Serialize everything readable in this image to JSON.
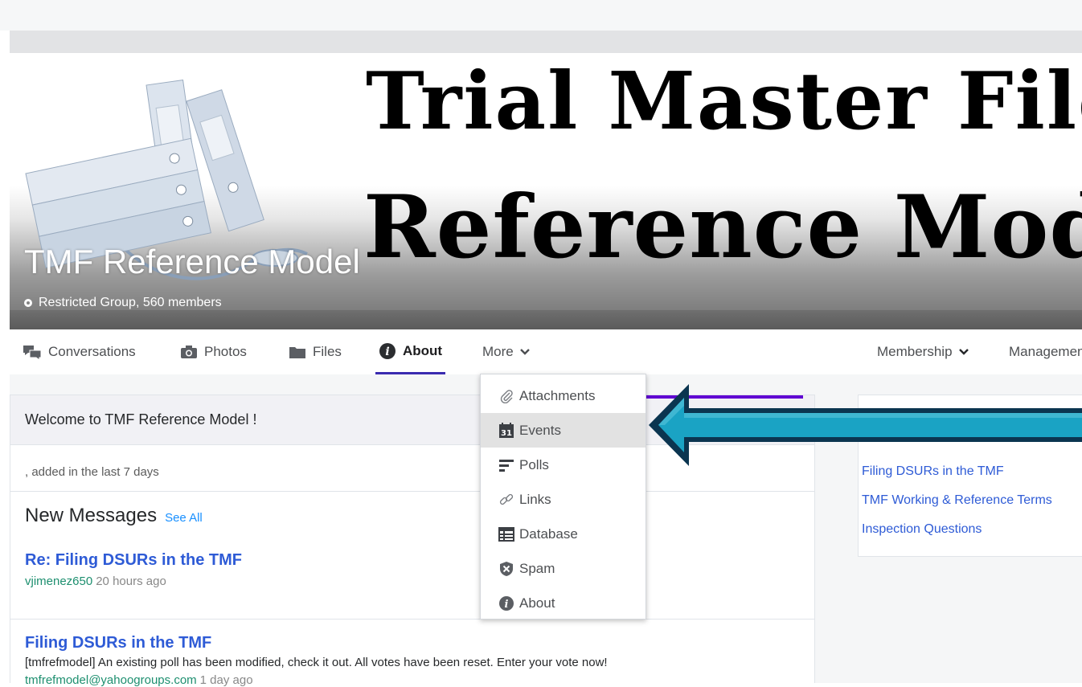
{
  "banner": {
    "title_line1": "Trial Master File",
    "title_line2": "Reference Model",
    "group_name": "TMF Reference Model",
    "group_meta": "Restricted Group, 560 members"
  },
  "nav": {
    "tabs": [
      {
        "label": "Conversations",
        "icon": "conversations-icon"
      },
      {
        "label": "Photos",
        "icon": "camera-icon"
      },
      {
        "label": "Files",
        "icon": "folder-icon"
      },
      {
        "label": "About",
        "icon": "info-icon",
        "active": true
      },
      {
        "label": "More",
        "icon": "chevron-down-icon"
      }
    ],
    "membership_label": "Membership",
    "management_label": "Management"
  },
  "more_menu": {
    "items": [
      {
        "label": "Attachments",
        "icon": "paperclip-icon"
      },
      {
        "label": "Events",
        "icon": "calendar-icon",
        "hovered": true
      },
      {
        "label": "Polls",
        "icon": "polls-icon"
      },
      {
        "label": "Links",
        "icon": "link-icon"
      },
      {
        "label": "Database",
        "icon": "database-icon"
      },
      {
        "label": "Spam",
        "icon": "spam-shield-icon"
      },
      {
        "label": "About",
        "icon": "info-icon"
      }
    ]
  },
  "calendar_icon_number": "31",
  "main": {
    "welcome": "Welcome to TMF Reference Model !",
    "recent": ", added in the last 7 days",
    "new_messages_title": "New Messages",
    "see_all": "See All",
    "messages": [
      {
        "title": "Re: Filing DSURs in the TMF",
        "author": "vjimenez650",
        "time": "20 hours ago"
      },
      {
        "title": "Filing DSURs in the TMF",
        "body": "[tmfrefmodel] An existing poll has been modified, check it out. All votes have been reset. Enter your vote now!",
        "author": "tmfrefmodel@yahoogroups.com",
        "time": "1 day ago"
      }
    ]
  },
  "sidebar": {
    "links": [
      "Filing DSURs in the TMF",
      "TMF Working & Reference Terms",
      "Inspection Questions"
    ]
  },
  "colors": {
    "active_tab_underline": "#3a2bb0",
    "link_blue": "#2e5bd6",
    "author_green": "#1d8f6f",
    "arrow_teal": "#1aa3c4",
    "arrow_border": "#0b3550"
  }
}
